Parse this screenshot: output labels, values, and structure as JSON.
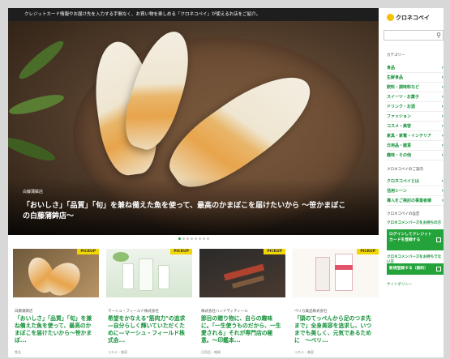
{
  "notice": "クレジットカード情報やお届け先を入力する手間なく、お買い物を楽しめる「クロネコペイ」が使えるお店をご紹介。",
  "hero": {
    "shop": "白藤蒲鉾店",
    "title": "「おいしさ」「品質」「旬」を兼ね備えた魚を使って、最高のかまぼこを届けたいから ～笹かまぼこの白藤蒲鉾店～"
  },
  "carousel": {
    "count": 8,
    "active": 0
  },
  "cards": [
    {
      "badge": "PICKUP",
      "shop": "白藤蒲鉾店",
      "title": "「おいしさ」「品質」「旬」を兼ね備えた魚を使って、最高のかまぼこを届けたいから～笹かまぼ...",
      "category": "食品"
    },
    {
      "badge": "PICKUP",
      "shop": "マーシュ・フィールド株式会社",
      "title": "希望をかなえる\"筋肉力\"の追求　—自分らしく輝いていただくために—マーシュ・フィールド株式会...",
      "category": "コスメ・美容"
    },
    {
      "badge": "PICKUP",
      "shop": "株式会社ハンドディティール",
      "title": "節目の贈り物に、自らの趣味に。「一生使うものだから、一生愛される」それが専門店の極意。～印鑑本...",
      "category": "日用品・雑貨"
    },
    {
      "badge": "PICKUP",
      "shop": "ペリカ薬品株式会社",
      "title": "「頭のてっぺんから足のつま先まで」全身美容を追求し、いつまでも美しく、元気であるために　～ペリ...",
      "category": "コスメ・美容"
    }
  ],
  "sidebar": {
    "logo": "クロネコペイ",
    "search_placeholder": "",
    "category_heading": "カテゴリー",
    "categories": [
      "食品",
      "生鮮食品",
      "飲料・調味料など",
      "スイーツ・お菓子",
      "ドリンク・お酒",
      "ファッション",
      "コスメ・美容",
      "家具・家電・インテリア",
      "日用品・雑貨",
      "趣味・その他"
    ],
    "guide_heading": "クロネコペイのご案内",
    "guide_items": [
      "クロネコペイとは",
      "活用シーン",
      "導入をご検討の事業者様"
    ],
    "member_heading": "クロネコペイの設定",
    "member_sub": "クロネコメンバーズをお持ちの方",
    "login_btn": "ログインしてクレジットカードを登録する",
    "nonmember_sub": "クロネコメンバーズをお持ちでない方",
    "register_btn": "新規登録する（無料）",
    "sitepolicy": "サイトポリシー"
  }
}
